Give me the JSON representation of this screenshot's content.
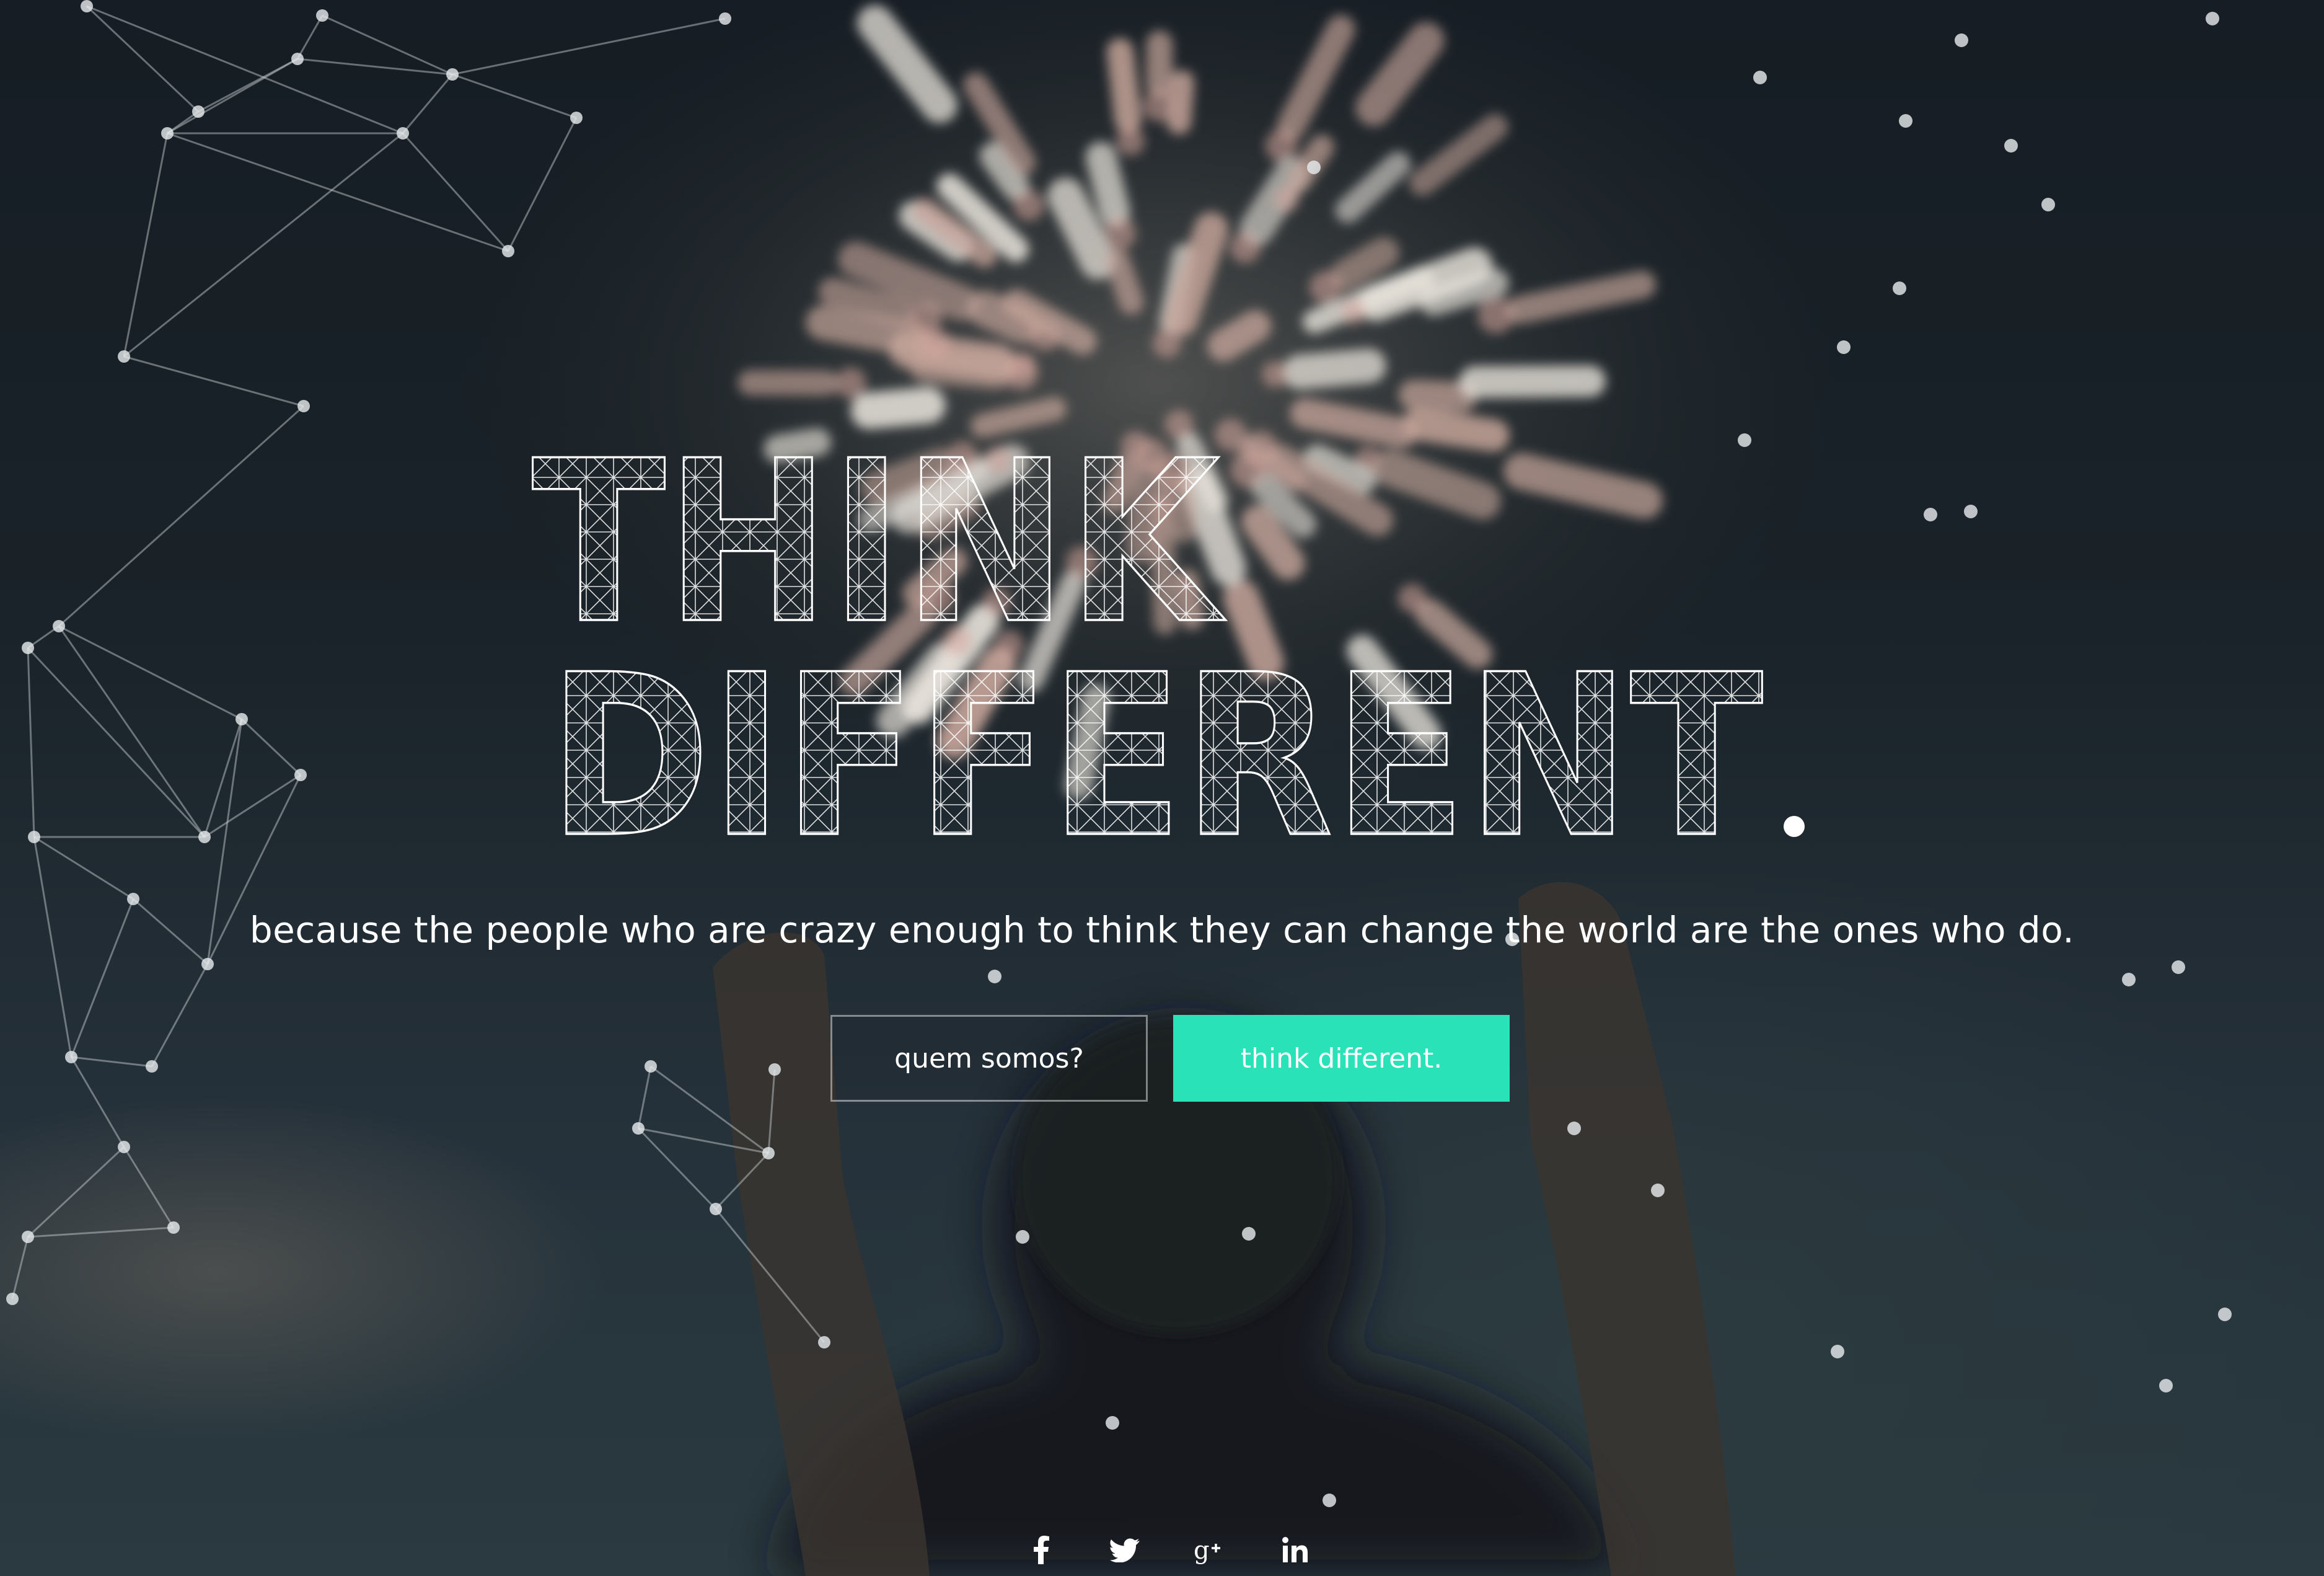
{
  "hero": {
    "headline_line1": "THINK",
    "headline_line2": "DIFFERENT",
    "headline_dot": ".",
    "tagline": "because the people who are crazy enough to think they can change the world are the ones who do."
  },
  "buttons": {
    "about_label": "quem somos?",
    "cta_label": "think different."
  },
  "social": [
    {
      "icon": "facebook-icon"
    },
    {
      "icon": "twitter-icon"
    },
    {
      "icon": "google-plus-icon"
    },
    {
      "icon": "linkedin-icon"
    }
  ],
  "colors": {
    "accent": "#29e2b7",
    "text": "#ffffff",
    "background": "#161d24"
  }
}
